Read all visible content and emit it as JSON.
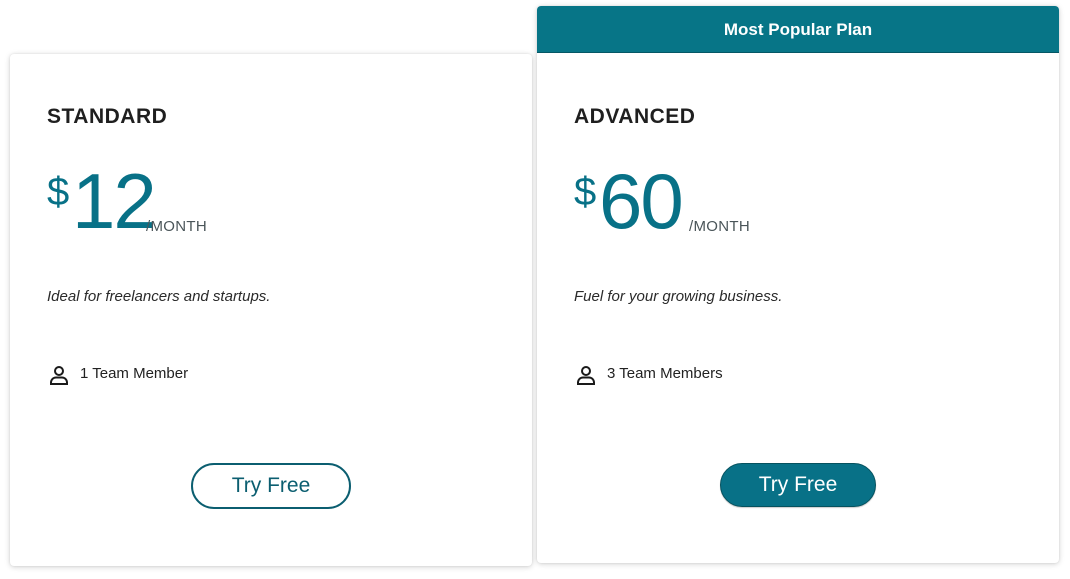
{
  "colors": {
    "accent": "#087187",
    "banner": "#077587",
    "text": "#1f1f1f"
  },
  "plans": [
    {
      "name": "STANDARD",
      "currency": "$",
      "amount": "12",
      "period": "/MONTH",
      "tagline": "Ideal for freelancers and startups.",
      "members": "1 Team Member",
      "member_icon": "user-icon",
      "cta": "Try Free",
      "cta_style": "outline"
    },
    {
      "badge": "Most Popular Plan",
      "name": "ADVANCED",
      "currency": "$",
      "amount": "60",
      "period": "/MONTH",
      "tagline": "Fuel for your growing business.",
      "members": "3 Team Members",
      "member_icon": "user-icon",
      "cta": "Try Free",
      "cta_style": "filled"
    }
  ]
}
